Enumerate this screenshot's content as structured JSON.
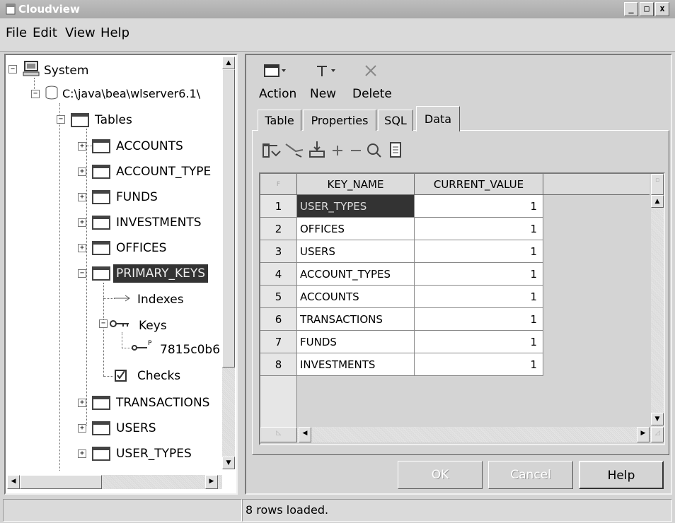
{
  "window": {
    "title": "Cloudview",
    "min_label": "_",
    "max_label": "□",
    "close_label": "x"
  },
  "menu": [
    "File",
    "Edit",
    "View",
    "Help"
  ],
  "tree": {
    "root": "System",
    "server": "C:\\java\\bea\\wlserver6.1\\",
    "tables_label": "Tables",
    "tables": [
      "ACCOUNTS",
      "ACCOUNT_TYPE",
      "FUNDS",
      "INVESTMENTS",
      "OFFICES",
      "PRIMARY_KEYS"
    ],
    "primary_children": {
      "indexes": "Indexes",
      "keys": "Keys",
      "key_id": "7815c0b6",
      "checks": "Checks"
    },
    "tables_after": [
      "TRANSACTIONS",
      "USERS",
      "USER_TYPES"
    ],
    "selected": "PRIMARY_KEYS"
  },
  "toolbar": {
    "action_label": "Action",
    "new_label": "New",
    "delete_label": "Delete"
  },
  "tabs": [
    {
      "label": "Table",
      "active": false
    },
    {
      "label": "Properties",
      "active": false
    },
    {
      "label": "SQL",
      "active": false
    },
    {
      "label": "Data",
      "active": true
    }
  ],
  "data_toolbar_icons": [
    "insert-row-icon",
    "undo-icon",
    "import-icon",
    "add-icon",
    "remove-icon",
    "find-icon",
    "document-icon"
  ],
  "grid": {
    "corner_label": "F",
    "columns": [
      "KEY_NAME",
      "CURRENT_VALUE"
    ],
    "rows": [
      {
        "n": "1",
        "key": "USER_TYPES",
        "value": "1"
      },
      {
        "n": "2",
        "key": "OFFICES",
        "value": "1"
      },
      {
        "n": "3",
        "key": "USERS",
        "value": "1"
      },
      {
        "n": "4",
        "key": "ACCOUNT_TYPES",
        "value": "1"
      },
      {
        "n": "5",
        "key": "ACCOUNTS",
        "value": "1"
      },
      {
        "n": "6",
        "key": "TRANSACTIONS",
        "value": "1"
      },
      {
        "n": "7",
        "key": "FUNDS",
        "value": "1"
      },
      {
        "n": "8",
        "key": "INVESTMENTS",
        "value": "1"
      }
    ],
    "selected_row": "1"
  },
  "buttons": {
    "ok": "OK",
    "cancel": "Cancel",
    "help": "Help"
  },
  "status": {
    "left": "",
    "right": "8 rows loaded."
  }
}
